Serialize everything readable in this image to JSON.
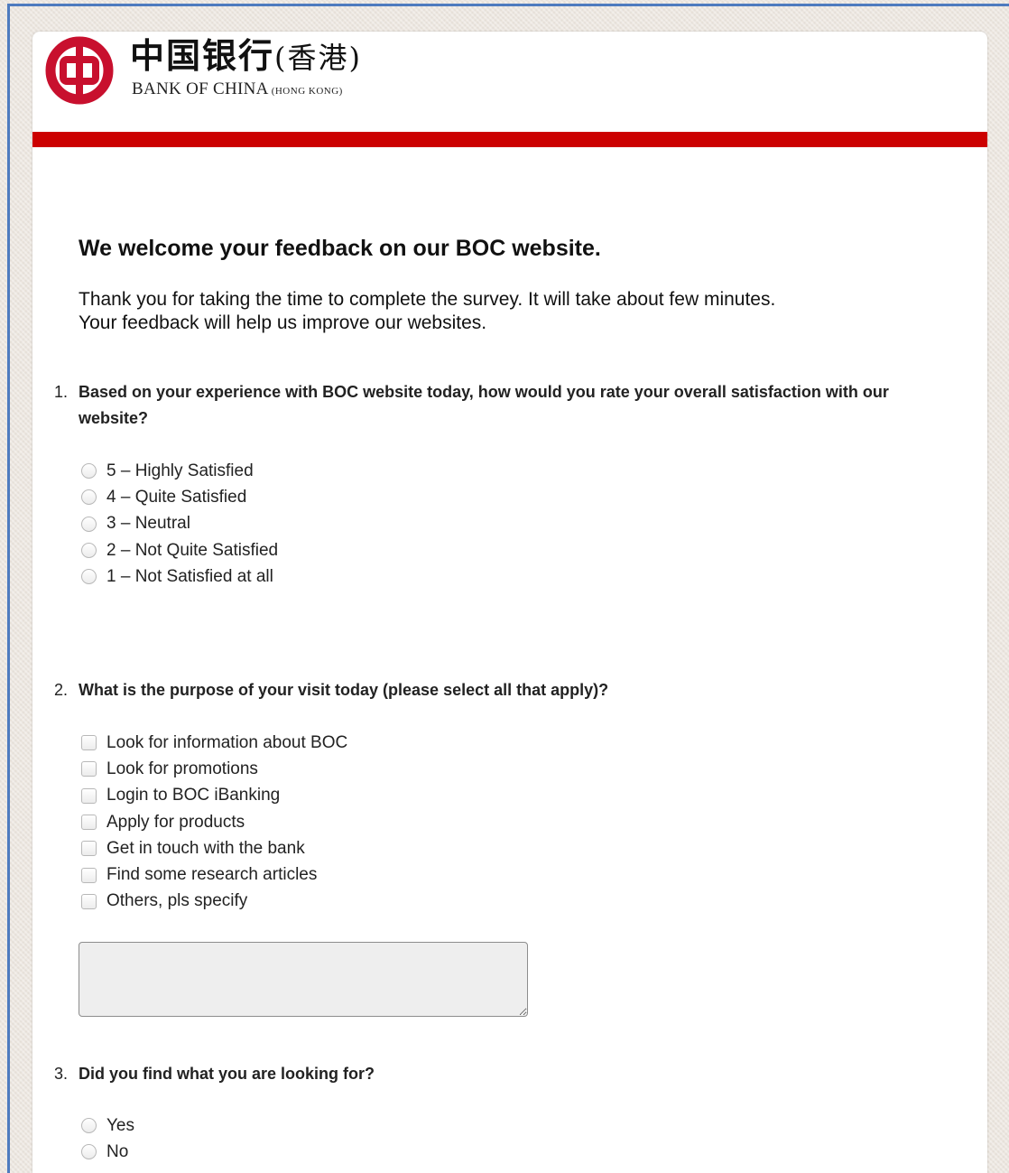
{
  "brand": {
    "name_cn": "中国银行",
    "name_cn_region": "(香港)",
    "name_en": "BANK OF CHINA",
    "name_en_region": "(HONG KONG)",
    "accent_color": "#cc0000"
  },
  "page": {
    "title": "We welcome your feedback on our BOC website.",
    "intro_line1": "Thank you for taking the time to complete the survey. It will take about few minutes.",
    "intro_line2": "Your feedback will help us improve our websites."
  },
  "questions": [
    {
      "number": "1.",
      "text": "Based on your experience with BOC website today, how would you rate your overall satisfaction with our website?",
      "type": "radio",
      "options": [
        "5 – Highly Satisfied",
        "4 – Quite Satisfied",
        "3 – Neutral",
        "2 – Not Quite Satisfied",
        "1 – Not Satisfied at all"
      ]
    },
    {
      "number": "2.",
      "text": "What is the purpose of your visit today (please select all that apply)?",
      "type": "checkbox",
      "options": [
        "Look for information about BOC",
        "Look for promotions",
        "Login to BOC iBanking",
        "Apply for products",
        "Get in touch with the bank",
        "Find some research articles",
        "Others, pls specify"
      ],
      "other_value": ""
    },
    {
      "number": "3.",
      "text": "Did you find what you are looking for?",
      "type": "radio",
      "options": [
        "Yes",
        "No"
      ]
    }
  ]
}
